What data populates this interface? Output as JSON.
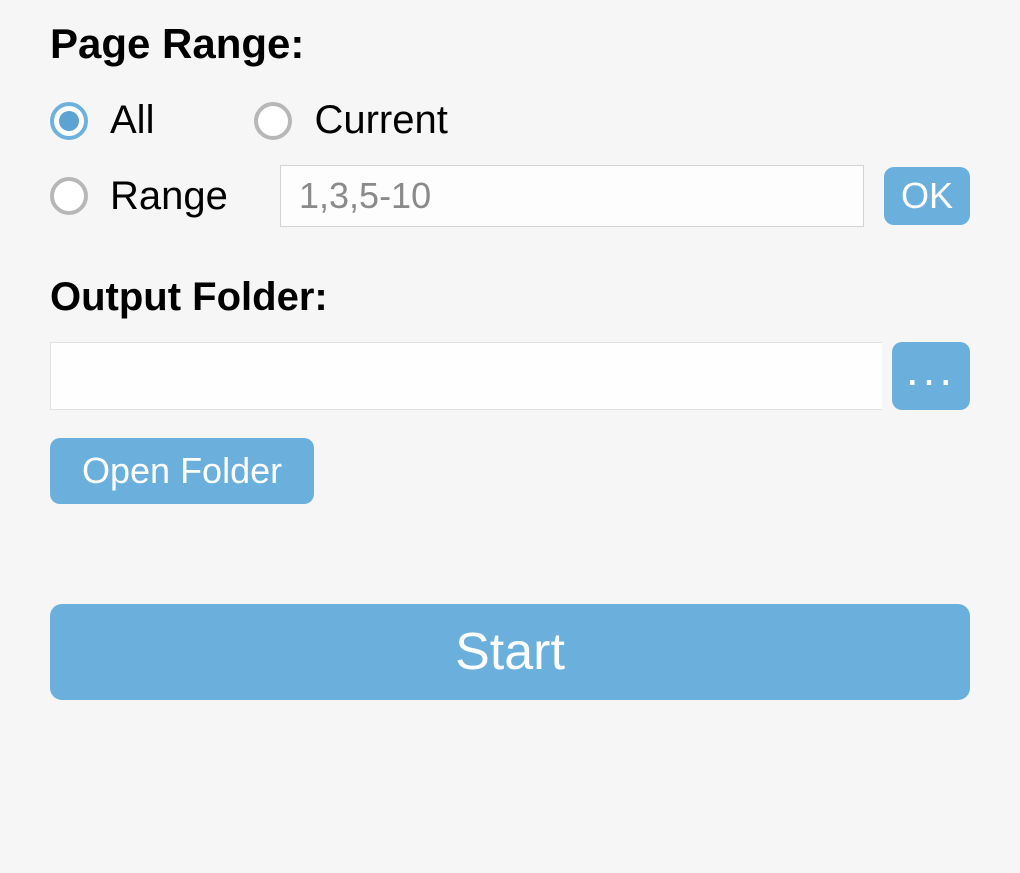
{
  "page_range": {
    "heading": "Page Range:",
    "options": {
      "all": {
        "label": "All",
        "checked": true
      },
      "current": {
        "label": "Current",
        "checked": false
      },
      "range": {
        "label": "Range",
        "checked": false
      }
    },
    "range_input_placeholder": "1,3,5-10",
    "range_input_value": "",
    "ok_button": "OK"
  },
  "output_folder": {
    "heading": "Output Folder:",
    "path_value": "",
    "browse_label": "...",
    "open_folder_label": "Open Folder"
  },
  "start_button": "Start",
  "colors": {
    "accent": "#6bb0dd",
    "radio_border_unchecked": "#b7b7b7",
    "radio_border_checked": "#6eb1dd",
    "background": "#f6f6f6"
  }
}
